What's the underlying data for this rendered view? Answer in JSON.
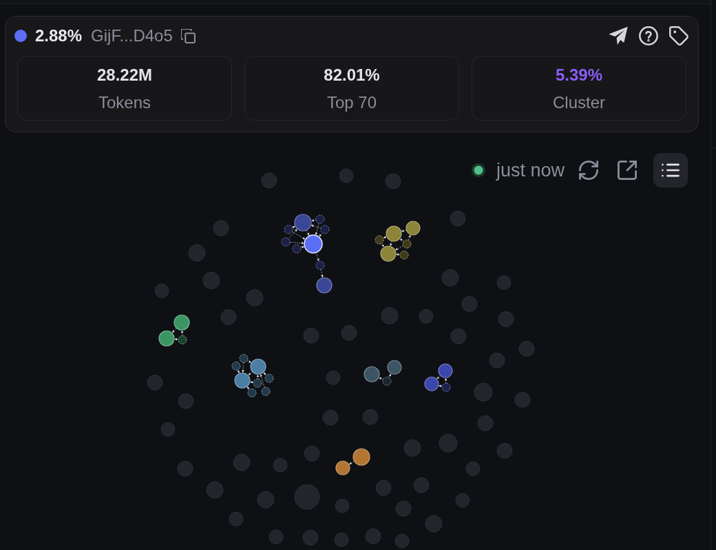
{
  "holder": {
    "color": "#5b6ef5",
    "share": "2.88%",
    "address": "GijF...D4o5"
  },
  "stats": [
    {
      "value": "28.22M",
      "label": "Tokens",
      "color": "#e4e4e7"
    },
    {
      "value": "82.01%",
      "label": "Top 70",
      "color": "#e4e4e7"
    },
    {
      "value": "5.39%",
      "label": "Cluster",
      "color": "#8b5cf6"
    }
  ],
  "status": {
    "live": true,
    "label": "just now"
  },
  "clusters": [
    {
      "color": "#3a4696"
    },
    {
      "color": "#8c8438"
    },
    {
      "color": "#3b9563"
    },
    {
      "color": "#4b7ea3"
    },
    {
      "color": "#3c5463"
    },
    {
      "color": "#3c47ad"
    },
    {
      "color": "#b27632"
    }
  ]
}
